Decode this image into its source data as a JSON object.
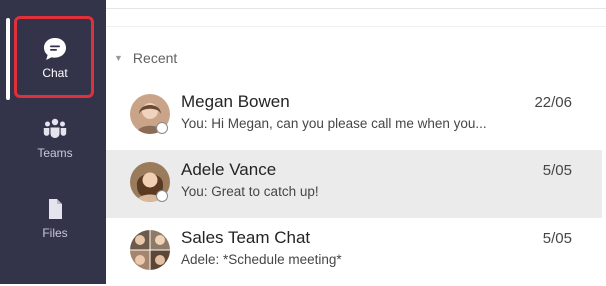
{
  "rail": {
    "items": [
      {
        "label": "Chat",
        "icon": "chat-bubble-icon",
        "active": true
      },
      {
        "label": "Teams",
        "icon": "teams-icon",
        "active": false
      },
      {
        "label": "Files",
        "icon": "file-icon",
        "active": false
      }
    ]
  },
  "chat_list": {
    "section_label": "Recent",
    "chats": [
      {
        "name": "Megan Bowen",
        "preview": "You: Hi Megan, can you please call me when you...",
        "date": "22/06",
        "selected": false
      },
      {
        "name": "Adele Vance",
        "preview": "You: Great to catch up!",
        "date": "5/05",
        "selected": true
      },
      {
        "name": "Sales Team Chat",
        "preview": "Adele: *Schedule meeting*",
        "date": "5/05",
        "selected": false
      }
    ]
  },
  "colors": {
    "rail_background": "#33344a",
    "highlight_border": "#e0303a",
    "selected_row": "#ebebeb"
  }
}
